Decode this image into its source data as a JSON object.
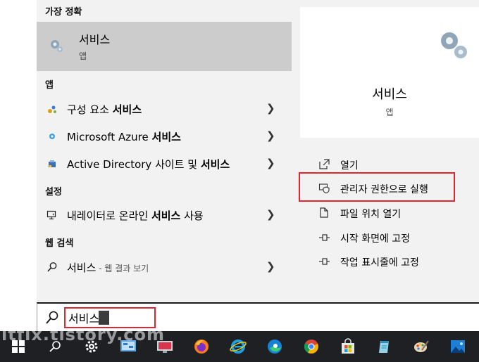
{
  "left_panel": {
    "best_match_header": "가장 정확",
    "best_match": {
      "title": "서비스",
      "subtitle": "앱"
    },
    "apps_header": "앱",
    "apps": [
      {
        "prefix": "구성 요소 ",
        "bold": "서비스",
        "suffix": ""
      },
      {
        "prefix": "Microsoft Azure ",
        "bold": "서비스",
        "suffix": ""
      },
      {
        "prefix": "Active Directory 사이트 및 ",
        "bold": "서비스",
        "suffix": ""
      }
    ],
    "settings_header": "설정",
    "settings": [
      {
        "prefix": "내레이터로 온라인 ",
        "bold": "서비스",
        "suffix": " 사용"
      }
    ],
    "web_header": "웹 검색",
    "web": {
      "query": "서비스",
      "sub": " - 웹 결과 보기"
    }
  },
  "right_panel": {
    "app_name": "서비스",
    "app_type": "앱",
    "actions": [
      "열기",
      "관리자 권한으로 실행",
      "파일 위치 열기",
      "시작 화면에 고정",
      "작업 표시줄에 고정"
    ]
  },
  "search": {
    "value": "서비스"
  },
  "watermark": "itfix.tistory.com",
  "taskbar": {
    "icons": [
      "windows-start-icon",
      "search-icon",
      "settings-gear-icon",
      "control-panel-icon",
      "remote-desktop-icon",
      "firefox-icon",
      "internet-explorer-icon",
      "edge-icon",
      "chrome-icon",
      "microsoft-store-icon",
      "notepad-icon",
      "paint-icon",
      "photos-icon"
    ]
  },
  "colors": {
    "highlight_box": "#e0262e",
    "menu_bg": "#f2f2f2",
    "selected_bg": "#cccccc",
    "taskbar_bg": "#1e2024"
  }
}
